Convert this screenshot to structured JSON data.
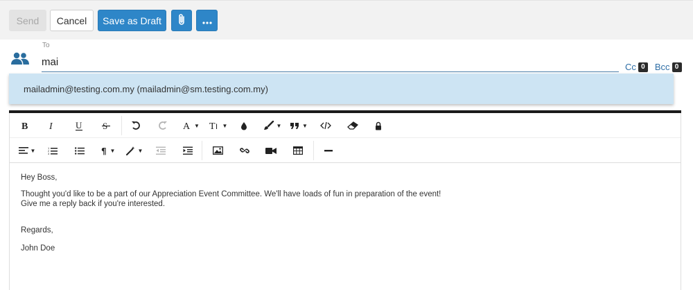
{
  "toolbar": {
    "send_label": "Send",
    "cancel_label": "Cancel",
    "draft_label": "Save as Draft",
    "attach_icon": "paperclip-icon",
    "more_icon": "ellipsis-icon"
  },
  "recipient": {
    "to_label": "To",
    "to_value": "mai",
    "cc_label": "Cc",
    "cc_count": "0",
    "bcc_label": "Bcc",
    "bcc_count": "0"
  },
  "suggestion": {
    "text": "mailadmin@testing.com.my (mailadmin@sm.testing.com.my)"
  },
  "editor": {
    "body": {
      "greeting": "Hey Boss,",
      "line1": "Thought you'd like to be a part of our Appreciation Event Committee. We'll have loads of fun in preparation of the event!",
      "line2": "Give me a reply back if you're interested.",
      "closing": "Regards,",
      "signature": "John Doe"
    }
  },
  "colors": {
    "primary": "#2e86c8",
    "suggestion_bg": "#cde4f3",
    "link": "#2e6ea6"
  }
}
